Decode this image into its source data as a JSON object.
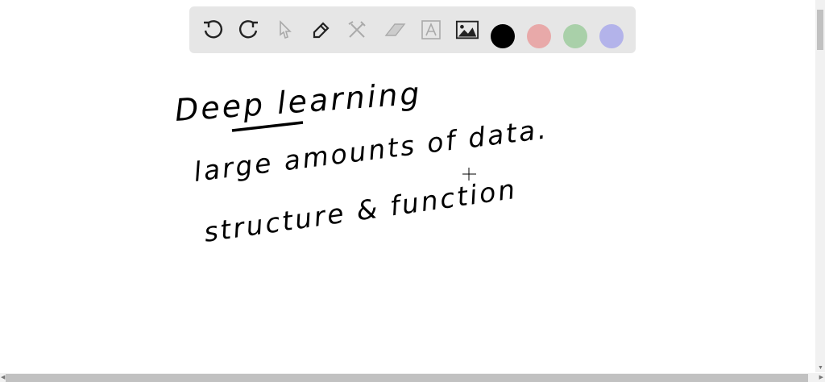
{
  "toolbar": {
    "tools": [
      "undo-icon",
      "redo-icon",
      "select-icon",
      "pen-icon",
      "tools-icon",
      "eraser-icon",
      "text-icon",
      "image-icon"
    ],
    "colors": [
      "#000000",
      "#e8a9a9",
      "#a9d0a9",
      "#b3b3ea"
    ]
  },
  "notes": {
    "title": "Deep learning",
    "line1": "large amounts of data.",
    "line2": "structure & function"
  }
}
